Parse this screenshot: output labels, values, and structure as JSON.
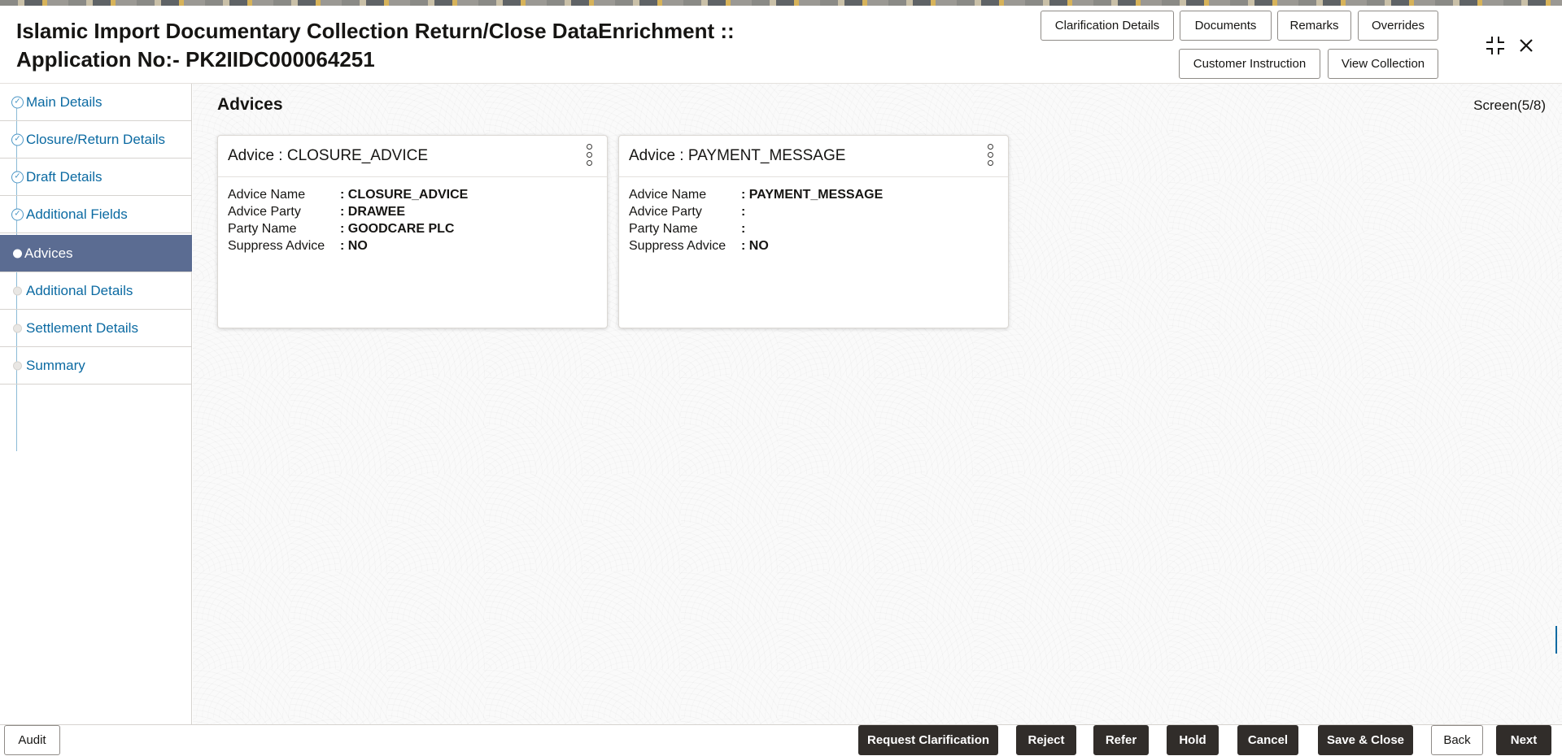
{
  "header": {
    "title": "Islamic Import Documentary Collection Return/Close DataEnrichment :: Application No:- PK2IIDC000064251",
    "buttons": {
      "clarification_details": "Clarification Details",
      "documents": "Documents",
      "remarks": "Remarks",
      "overrides": "Overrides",
      "customer_instruction": "Customer Instruction",
      "view_collection": "View Collection"
    },
    "icons": {
      "minimize": "minimize-icon",
      "close": "close-icon"
    }
  },
  "sidebar": {
    "items": [
      {
        "label": "Main Details",
        "state": "completed"
      },
      {
        "label": "Closure/Return Details",
        "state": "completed"
      },
      {
        "label": "Draft Details",
        "state": "completed"
      },
      {
        "label": "Additional Fields",
        "state": "completed"
      },
      {
        "label": "Advices",
        "state": "active"
      },
      {
        "label": "Additional Details",
        "state": "pending"
      },
      {
        "label": "Settlement Details",
        "state": "pending"
      },
      {
        "label": "Summary",
        "state": "pending"
      }
    ]
  },
  "main": {
    "section_title": "Advices",
    "screen_indicator": "Screen(5/8)",
    "cards": [
      {
        "title": "Advice : CLOSURE_ADVICE",
        "rows": [
          {
            "label": "Advice Name",
            "value": ": CLOSURE_ADVICE"
          },
          {
            "label": "Advice Party",
            "value": ": DRAWEE"
          },
          {
            "label": "Party Name",
            "value": ": GOODCARE PLC"
          },
          {
            "label": "Suppress Advice",
            "value": ": NO"
          }
        ]
      },
      {
        "title": "Advice : PAYMENT_MESSAGE",
        "rows": [
          {
            "label": "Advice Name",
            "value": ": PAYMENT_MESSAGE"
          },
          {
            "label": "Advice Party",
            "value": ":"
          },
          {
            "label": "Party Name",
            "value": ":"
          },
          {
            "label": "Suppress Advice",
            "value": ": NO"
          }
        ]
      }
    ]
  },
  "footer": {
    "audit": "Audit",
    "request_clarification": "Request Clarification",
    "reject": "Reject",
    "refer": "Refer",
    "hold": "Hold",
    "cancel": "Cancel",
    "save_close": "Save & Close",
    "back": "Back",
    "next": "Next"
  },
  "colors": {
    "active_nav": "#5b6c92",
    "link": "#0b6aa2",
    "dark_button": "#312d2a"
  }
}
